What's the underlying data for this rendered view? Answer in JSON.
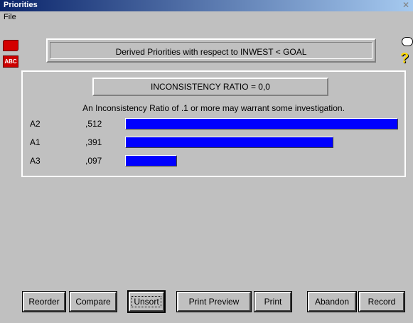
{
  "window": {
    "title": "Priorities"
  },
  "menu": {
    "file": "File"
  },
  "icons": {
    "abc": "ABC",
    "help": "?"
  },
  "header": {
    "text": "Derived Priorities with respect to INWEST < GOAL"
  },
  "ratio": {
    "text": "INCONSISTENCY RATIO = 0,0"
  },
  "note": "An Inconsistency Ratio of .1 or more may warrant some investigation.",
  "colors": {
    "bar": "#0000ff",
    "background": "#c0c0c0"
  },
  "chart_data": {
    "type": "bar",
    "categories": [
      "A2",
      "A1",
      "A3"
    ],
    "values": [
      0.512,
      0.391,
      0.097
    ],
    "value_labels": [
      ",512",
      ",391",
      ",097"
    ]
  },
  "buttons": {
    "reorder": "Reorder",
    "compare": "Compare",
    "unsort": "Unsort",
    "print_preview": "Print Preview",
    "print": "Print",
    "abandon": "Abandon",
    "record": "Record"
  }
}
